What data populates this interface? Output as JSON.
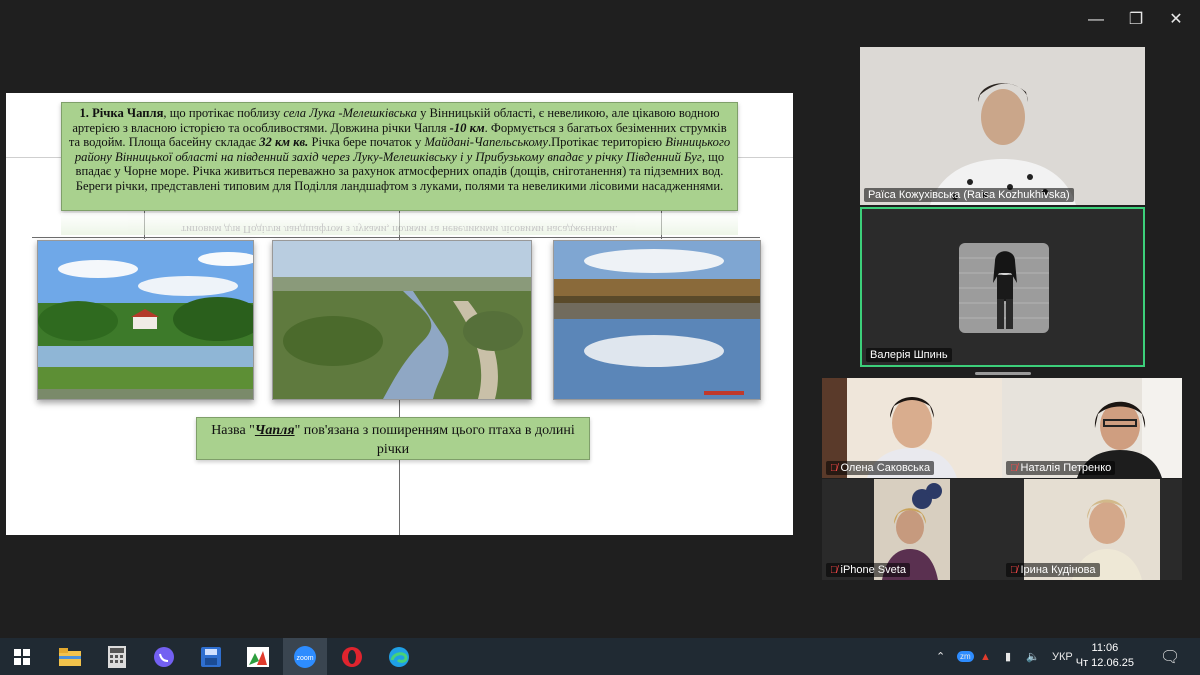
{
  "window_controls": {
    "minimize": "—",
    "maximize": "❐",
    "close": "✕"
  },
  "slide": {
    "info_html": "<b>1. Річка Чапля</b>, що протікає поблизу <i>села Лука -Мелешківська</i> у Вінницькій області, є невеликою, але цікавою водною артерією з власною історією та особливостями. Довжина річки Чапля <b><i>-10 км</i></b>. Формується з багатьох безіменних струмків та водойм. Площа басейну складає <b><i>32 км кв.</i></b> Річка бере початок у <i>Майдані-Чапельському</i>.Протікає територією <i>Вінницького району Вінницької області на південний захід через Луку-Мелешківську і у Прибузькому впадає у річку Південний Буг</i>, що впадає у Чорне море. Річка живиться переважно за рахунок атмосферних опадів (дощів, сніготанення) та підземних вод. Береги річки, представлені типовим для Поділля ландшафтом з луками, полями та невеликими лісовими насадженнями.",
    "reflection_text": "типовим для Поділля ландшафтом з луками, полями та невеликими лісовими насадженнями.",
    "caption_html": "Назва \"<u>Чапля</u>\" пов'язана з поширенням цього птаха в долині річки"
  },
  "participants": [
    {
      "name": "Раїса Кожухівська (Raisa Kozhukhivska)",
      "muted": false
    },
    {
      "name": "Валерія Шпинь",
      "muted": false,
      "active_speaker": true
    },
    {
      "name": "Олена Саковська",
      "muted": true
    },
    {
      "name": "Наталія Петренко",
      "muted": true
    },
    {
      "name": "iPhone Sveta",
      "muted": true
    },
    {
      "name": "Ірина  Кудінова",
      "muted": true
    }
  ],
  "taskbar": {
    "language": "УКР",
    "time": "11:06",
    "date": "Чт 12.06.25",
    "apps": [
      "windows-start",
      "file-explorer",
      "calculator",
      "viber",
      "save-disk",
      "photo-app",
      "zoom",
      "opera",
      "edge"
    ]
  },
  "colors": {
    "slide_box": "#a9d18e",
    "active_speaker_border": "#3ccf7a",
    "taskbar": "#202a33",
    "background": "#1f1f1f"
  }
}
